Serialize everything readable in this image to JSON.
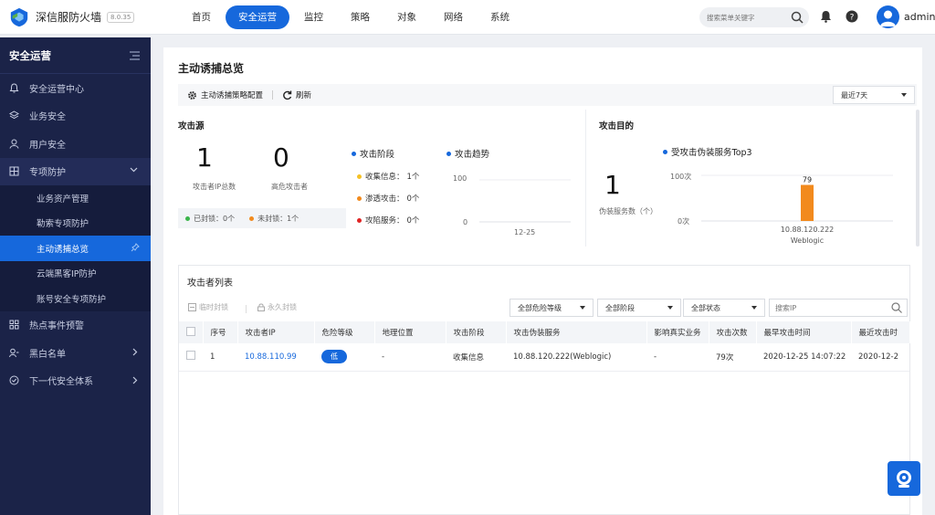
{
  "brand": {
    "title": "深信服防火墙",
    "version": "8.0.35"
  },
  "nav": [
    {
      "label": "首页",
      "active": false
    },
    {
      "label": "安全运营",
      "active": true
    },
    {
      "label": "监控",
      "active": false
    },
    {
      "label": "策略",
      "active": false
    },
    {
      "label": "对象",
      "active": false
    },
    {
      "label": "网络",
      "active": false
    },
    {
      "label": "系统",
      "active": false
    }
  ],
  "header": {
    "search_placeholder": "搜索菜单关键字",
    "username": "admin"
  },
  "sidebar": {
    "title": "安全运营",
    "items": [
      {
        "label": "安全运营中心",
        "icon": "bell-icon"
      },
      {
        "label": "业务安全",
        "icon": "layers-icon"
      },
      {
        "label": "用户安全",
        "icon": "user-icon"
      },
      {
        "label": "专项防护",
        "icon": "shield-grid-icon",
        "expanded": true
      },
      {
        "label": "热点事件预警",
        "icon": "grid-icon"
      },
      {
        "label": "黑白名单",
        "icon": "user-list-icon"
      },
      {
        "label": "下一代安全体系",
        "icon": "shield-check-icon"
      }
    ],
    "subitems": [
      {
        "label": "业务资产管理",
        "active": false
      },
      {
        "label": "勒索专项防护",
        "active": false
      },
      {
        "label": "主动诱捕总览",
        "active": true
      },
      {
        "label": "云端黑客IP防护",
        "active": false
      },
      {
        "label": "账号安全专项防护",
        "active": false
      }
    ]
  },
  "page": {
    "title": "主动诱捕总览",
    "toolbar": {
      "config_label": "主动诱捕策略配置",
      "refresh_label": "刷新",
      "date_range": "最近7天"
    }
  },
  "attack_source": {
    "title": "攻击源",
    "kpis": [
      {
        "value": "1",
        "label": "攻击者IP总数"
      },
      {
        "value": "0",
        "label": "高危攻击者"
      }
    ],
    "blocked_label": "已封锁：0个",
    "unblocked_label": "未封锁：1个",
    "stage_title": "攻击阶段",
    "stages": [
      {
        "label": "收集信息：",
        "count": "1个",
        "color": "#f5c125"
      },
      {
        "label": "渗透攻击：",
        "count": "0个",
        "color": "#f28a1d"
      },
      {
        "label": "攻陷服务：",
        "count": "0个",
        "color": "#e02424"
      }
    ],
    "trend_title": "攻击趋势",
    "trend_y": [
      "100",
      "0"
    ],
    "trend_x": [
      "12-25"
    ]
  },
  "attack_target": {
    "title": "攻击目的",
    "kpi": {
      "value": "1",
      "label": "伪装服务数（个）"
    },
    "chart_title": "受攻击伪装服务Top3",
    "y_ticks": [
      "100次",
      "0次"
    ]
  },
  "chart_data": {
    "type": "bar",
    "title": "受攻击伪装服务Top3",
    "categories": [
      "10.88.120.222"
    ],
    "category_sublabels": [
      "Weblogic"
    ],
    "values": [
      79
    ],
    "data_labels": [
      "79"
    ],
    "ylim": [
      0,
      100
    ],
    "y_ticks": [
      "100次",
      "0次"
    ],
    "bar_color": "#f28a1d"
  },
  "attacker_list": {
    "title": "攻击者列表",
    "temp_block_label": "临时封锁",
    "perm_block_label": "永久封锁",
    "filters": [
      "全部危险等级",
      "全部阶段",
      "全部状态"
    ],
    "search_placeholder": "搜索IP",
    "columns": [
      "序号",
      "攻击者IP",
      "危险等级",
      "地理位置",
      "攻击阶段",
      "攻击伪装服务",
      "影响真实业务",
      "攻击次数",
      "最早攻击时间",
      "最近攻击时"
    ],
    "rows": [
      {
        "index": "1",
        "ip": "10.88.110.99",
        "risk": "低",
        "location": "-",
        "stage": "收集信息",
        "service": "10.88.120.222(Weblogic)",
        "real_business": "-",
        "count": "79次",
        "first_time": "2020-12-25 14:07:22",
        "last_time": "2020-12-2"
      }
    ]
  }
}
